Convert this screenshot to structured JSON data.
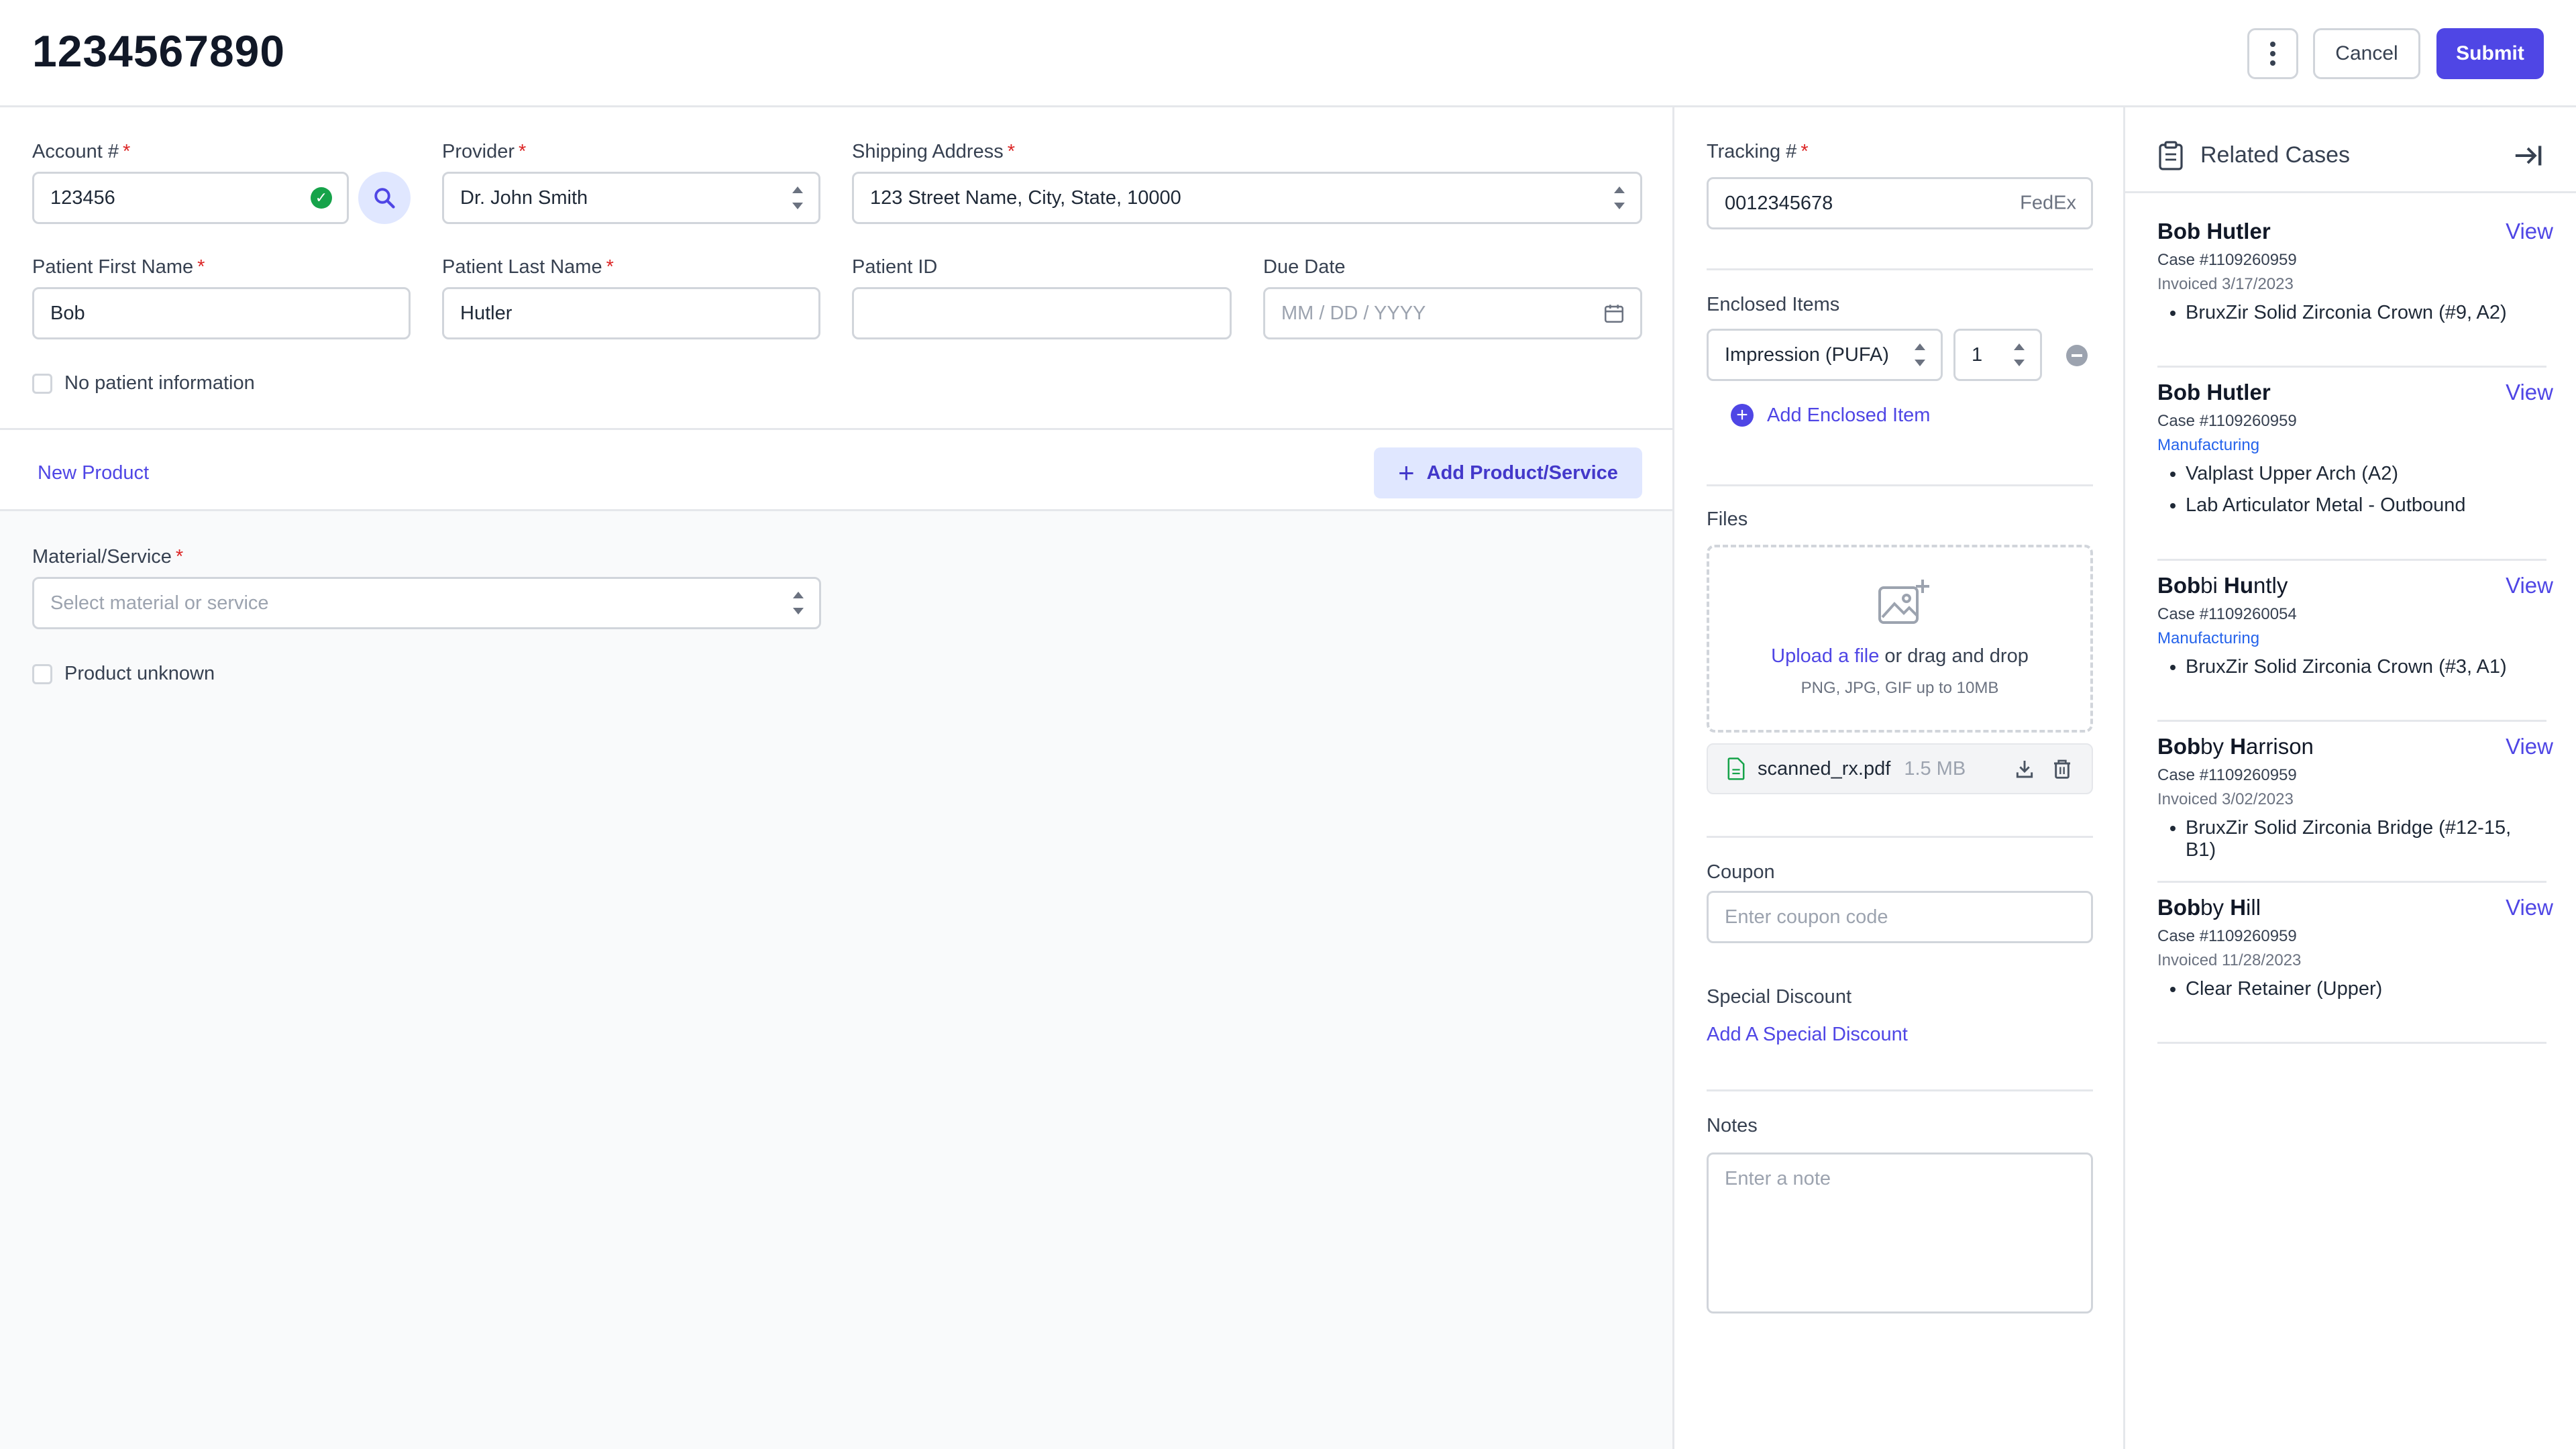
{
  "header": {
    "case_id": "1234567890",
    "cancel_label": "Cancel",
    "submit_label": "Submit"
  },
  "form": {
    "account_label": "Account #",
    "account_value": "123456",
    "provider_label": "Provider",
    "provider_value": "Dr. John Smith",
    "shipping_label": "Shipping Address",
    "shipping_value": "123 Street Name, City, State, 10000",
    "first_name_label": "Patient First Name",
    "first_name_value": "Bob",
    "last_name_label": "Patient Last Name",
    "last_name_value": "Hutler",
    "patient_id_label": "Patient ID",
    "due_date_label": "Due Date",
    "due_date_placeholder": "MM / DD / YYYY",
    "no_patient_label": "No patient information",
    "required_mark": "*"
  },
  "product": {
    "tab_label": "New Product",
    "add_button_label": "Add Product/Service",
    "material_label": "Material/Service",
    "material_placeholder": "Select material or service",
    "unknown_label": "Product unknown"
  },
  "shipping": {
    "tracking_label": "Tracking #",
    "tracking_value": "0012345678",
    "carrier": "FedEx",
    "enclosed_label": "Enclosed Items",
    "enclosed_item": "Impression (PUFA)",
    "enclosed_qty": "1",
    "add_enclosed_label": "Add Enclosed Item",
    "files_label": "Files",
    "upload_link": "Upload a file",
    "upload_text": "or drag and drop",
    "upload_hint": "PNG, JPG, GIF up to 10MB",
    "file_name": "scanned_rx.pdf",
    "file_size": "1.5 MB",
    "coupon_label": "Coupon",
    "coupon_placeholder": "Enter coupon code",
    "discount_label": "Special Discount",
    "discount_link": "Add A Special Discount",
    "notes_label": "Notes",
    "notes_placeholder": "Enter a note"
  },
  "related": {
    "title": "Related Cases",
    "view_label": "View",
    "cases": [
      {
        "name_bold": "Bob Hutler",
        "name_rest": "",
        "case_num": "Case #1109260959",
        "status": "Invoiced 3/17/2023",
        "items": [
          "BruxZir Solid Zirconia Crown (#9, A2)"
        ]
      },
      {
        "name_bold": "Bob Hutler",
        "name_rest": "",
        "case_num": "Case #1109260959",
        "status": "Manufacturing",
        "items": [
          "Valplast Upper Arch (A2)",
          "Lab Articulator Metal - Outbound"
        ]
      },
      {
        "name_a": "Bob",
        "name_b": "bi ",
        "name_c": "Hu",
        "name_d": "ntly",
        "case_num": "Case #1109260054",
        "status": "Manufacturing",
        "items": [
          "BruxZir Solid Zirconia Crown (#3, A1)"
        ]
      },
      {
        "name_a": "Bob",
        "name_b": "by ",
        "name_c": "H",
        "name_d": "arrison",
        "case_num": "Case #1109260959",
        "status": "Invoiced 3/02/2023",
        "items": [
          "BruxZir Solid Zirconia Bridge (#12-15, B1)"
        ]
      },
      {
        "name_a": "Bob",
        "name_b": "by ",
        "name_c": "H",
        "name_d": "ill",
        "case_num": "Case #1109260959",
        "status": "Invoiced 11/28/2023",
        "items": [
          "Clear Retainer (Upper)"
        ]
      }
    ]
  },
  "colors": {
    "primary": "#4f46e5",
    "success": "#16a34a",
    "required": "#dc2626"
  }
}
